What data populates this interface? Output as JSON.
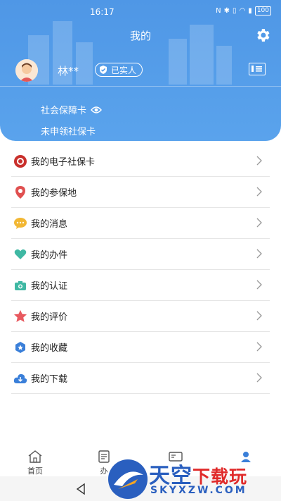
{
  "status_bar": {
    "time": "16:17",
    "battery": "100"
  },
  "header": {
    "title": "我的",
    "user_name": "林**",
    "verified_label": "已实人",
    "social_card_label": "社会保障卡",
    "social_card_status": "未申领社保卡"
  },
  "menu": [
    {
      "label": "我的电子社保卡",
      "icon": "ss-card-icon"
    },
    {
      "label": "我的参保地",
      "icon": "location-pin-icon"
    },
    {
      "label": "我的消息",
      "icon": "message-icon"
    },
    {
      "label": "我的办件",
      "icon": "heart-icon"
    },
    {
      "label": "我的认证",
      "icon": "camera-icon"
    },
    {
      "label": "我的评价",
      "icon": "star-icon"
    },
    {
      "label": "我的收藏",
      "icon": "bookmark-icon"
    },
    {
      "label": "我的下载",
      "icon": "cloud-download-icon"
    }
  ],
  "bottom_nav": {
    "home": "首页",
    "office": "办"
  },
  "watermark": {
    "main": "天空",
    "accent": "下载玩",
    "sub": "SKYXZW.COM"
  },
  "colors": {
    "header": "#4f97e6",
    "nav_active": "#3a7fd9"
  }
}
